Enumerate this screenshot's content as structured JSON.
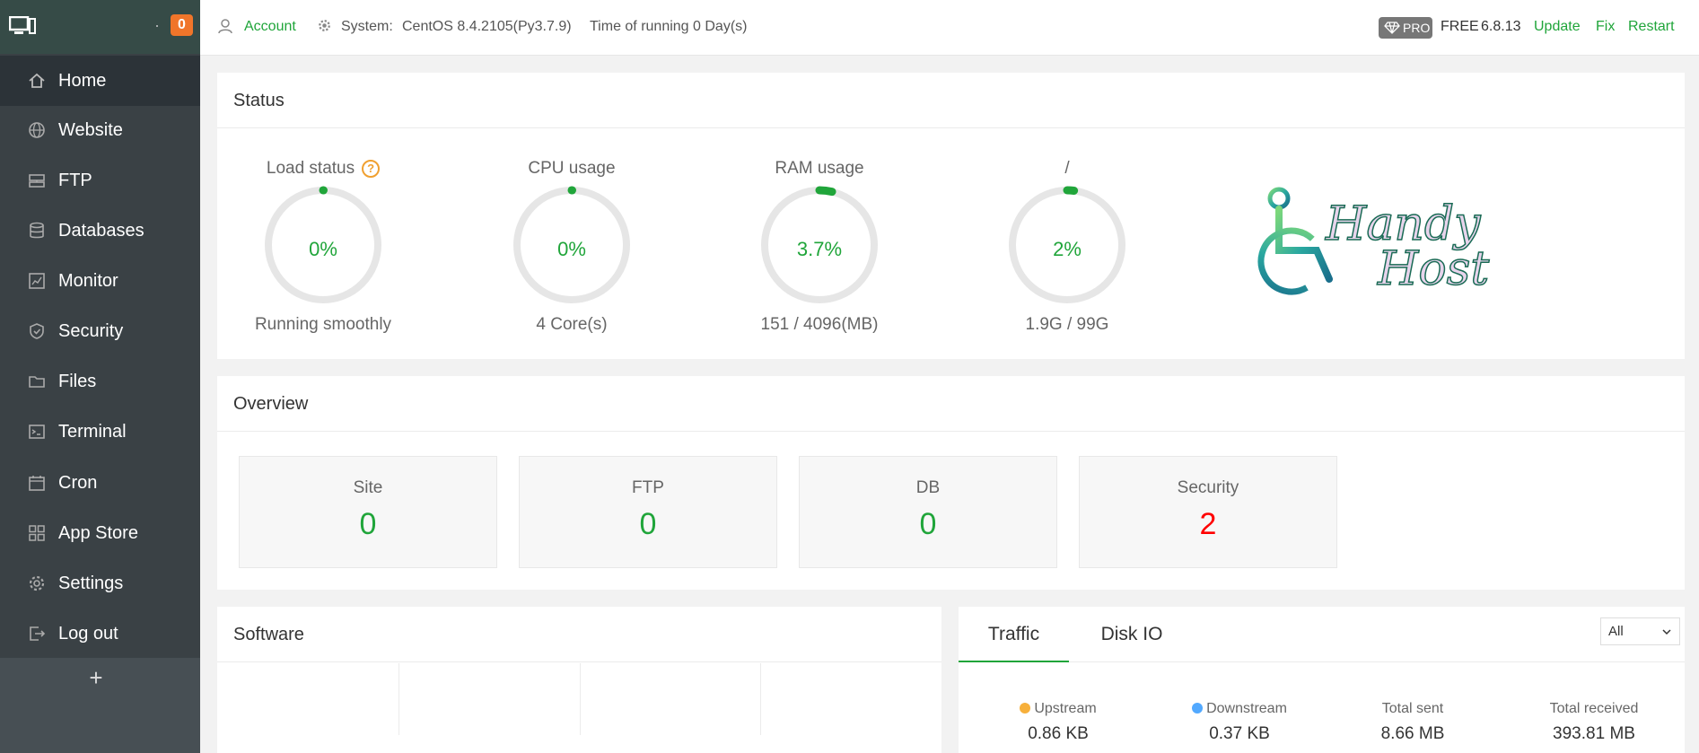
{
  "sidebar": {
    "notification_count": "0",
    "items": [
      {
        "label": "Home"
      },
      {
        "label": "Website"
      },
      {
        "label": "FTP"
      },
      {
        "label": "Databases"
      },
      {
        "label": "Monitor"
      },
      {
        "label": "Security"
      },
      {
        "label": "Files"
      },
      {
        "label": "Terminal"
      },
      {
        "label": "Cron"
      },
      {
        "label": "App Store"
      },
      {
        "label": "Settings"
      },
      {
        "label": "Log out"
      }
    ],
    "add_label": "+"
  },
  "header": {
    "account_link": "Account",
    "system_label": "System:",
    "system_value": "CentOS 8.4.2105(Py3.7.9)",
    "running_time": "Time of running 0 Day(s)",
    "pro_badge": "PRO",
    "edition": "FREE",
    "version": "6.8.13",
    "update_link": "Update",
    "fix_link": "Fix",
    "restart_link": "Restart"
  },
  "status": {
    "title": "Status",
    "gauges": [
      {
        "title": "Load status",
        "value": "0%",
        "subtitle": "Running smoothly",
        "percent": 0
      },
      {
        "title": "CPU usage",
        "value": "0%",
        "subtitle": "4 Core(s)",
        "percent": 0
      },
      {
        "title": "RAM usage",
        "value": "3.7%",
        "subtitle": "151 / 4096(MB)",
        "percent": 3.7
      },
      {
        "title": "/",
        "value": "2%",
        "subtitle": "1.9G / 99G",
        "percent": 2
      }
    ],
    "logo_text_1": "Handy",
    "logo_text_2": "Host"
  },
  "overview": {
    "title": "Overview",
    "cards": [
      {
        "label": "Site",
        "value": "0"
      },
      {
        "label": "FTP",
        "value": "0"
      },
      {
        "label": "DB",
        "value": "0"
      },
      {
        "label": "Security",
        "value": "2"
      }
    ]
  },
  "software": {
    "title": "Software"
  },
  "traffic": {
    "tabs": [
      "Traffic",
      "Disk IO"
    ],
    "selected_option": "All",
    "stats": [
      {
        "label": "Upstream",
        "value": "0.86 KB",
        "color": "#f7b03b"
      },
      {
        "label": "Downstream",
        "value": "0.37 KB",
        "color": "#52a9ff"
      },
      {
        "label": "Total sent",
        "value": "8.66 MB"
      },
      {
        "label": "Total received",
        "value": "393.81 MB"
      }
    ]
  },
  "colors": {
    "accent": "#20a53a",
    "sidebar_bg": "#3a4145",
    "danger": "#ff0000",
    "badge": "#f0752a"
  }
}
